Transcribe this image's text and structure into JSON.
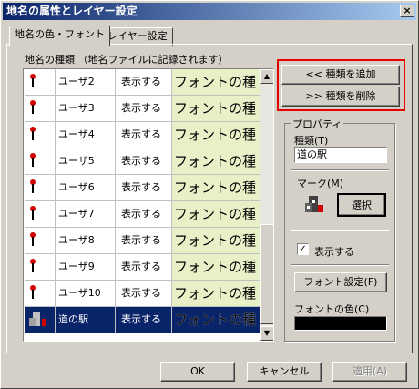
{
  "window": {
    "title": "地名の属性とレイヤー設定",
    "close": "×"
  },
  "tabs": [
    {
      "label": "地名の色・フォント"
    },
    {
      "label": "レイヤー設定"
    }
  ],
  "list": {
    "label": "地名の種類 （地名ファイルに記録されます）",
    "rows": [
      {
        "icon": "pin-icon",
        "name": "ユーザ2",
        "display": "表示する",
        "font": "フォントの種"
      },
      {
        "icon": "pin-icon",
        "name": "ユーザ3",
        "display": "表示する",
        "font": "フォントの種"
      },
      {
        "icon": "pin-icon",
        "name": "ユーザ4",
        "display": "表示する",
        "font": "フォントの種"
      },
      {
        "icon": "pin-icon",
        "name": "ユーザ5",
        "display": "表示する",
        "font": "フォントの種"
      },
      {
        "icon": "pin-icon",
        "name": "ユーザ6",
        "display": "表示する",
        "font": "フォントの種"
      },
      {
        "icon": "pin-icon",
        "name": "ユーザ7",
        "display": "表示する",
        "font": "フォントの種"
      },
      {
        "icon": "pin-icon",
        "name": "ユーザ8",
        "display": "表示する",
        "font": "フォントの種"
      },
      {
        "icon": "pin-icon",
        "name": "ユーザ9",
        "display": "表示する",
        "font": "フォントの種"
      },
      {
        "icon": "pin-icon",
        "name": "ユーザ10",
        "display": "表示する",
        "font": "フォントの種"
      },
      {
        "icon": "roadside-station-icon",
        "name": "道の駅",
        "display": "表示する",
        "font": "フォントの種",
        "selected": true
      }
    ]
  },
  "actions": {
    "add": "<< 種類を追加",
    "remove": ">> 種類を削除"
  },
  "properties": {
    "title": "プロパティ",
    "type_label": "種類(T)",
    "type_value": "道の駅",
    "mark_label": "マーク(M)",
    "select_button": "選択",
    "show_label": "表示する",
    "show_checked": true,
    "font_button": "フォント設定(F)",
    "font_color_label": "フォントの色(C)",
    "font_color": "#000000"
  },
  "footer": {
    "ok": "OK",
    "cancel": "キャンセル",
    "apply": "適用(A)"
  },
  "colors": {
    "highlight": "#e60000",
    "selection": "#0a246a",
    "font_cell": "#e8f0c8"
  }
}
